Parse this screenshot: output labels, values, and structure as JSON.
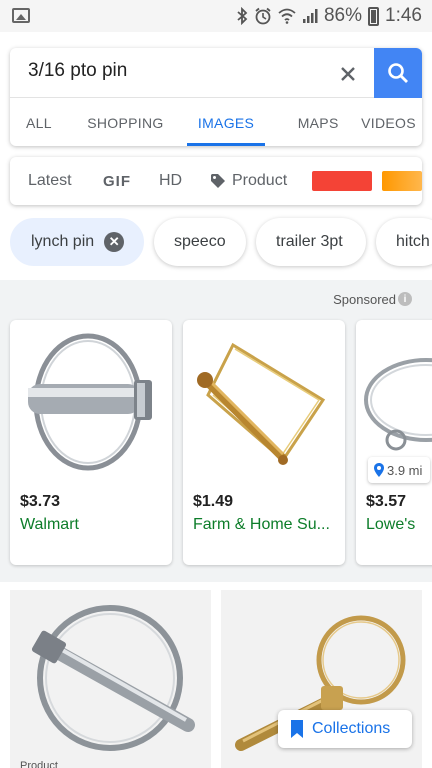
{
  "status_bar": {
    "battery": "86%",
    "time": "1:46",
    "icons": [
      "gallery-icon",
      "bluetooth-icon",
      "alarm-icon",
      "wifi-icon",
      "signal-icon",
      "battery-icon"
    ]
  },
  "search": {
    "query": "3/16 pto pin",
    "clear_icon": "close-icon",
    "search_icon": "search-icon",
    "accent": "#4285f4"
  },
  "tabs": [
    {
      "label": "ALL",
      "active": false
    },
    {
      "label": "SHOPPING",
      "active": false
    },
    {
      "label": "IMAGES",
      "active": true
    },
    {
      "label": "MAPS",
      "active": false
    },
    {
      "label": "VIDEOS",
      "active": false
    }
  ],
  "filters": {
    "latest": "Latest",
    "gif": "GIF",
    "hd": "HD",
    "product": "Product",
    "colors": [
      "#f44336",
      "#ff9800"
    ]
  },
  "chips": [
    {
      "label": "lynch pin",
      "active": true
    },
    {
      "label": "speeco",
      "active": false
    },
    {
      "label": "trailer 3pt",
      "active": false
    },
    {
      "label": "hitch",
      "active": false
    }
  ],
  "sponsored": {
    "label": "Sponsored",
    "items": [
      {
        "price": "$3.73",
        "store": "Walmart"
      },
      {
        "price": "$1.49",
        "store": "Farm & Home Su..."
      },
      {
        "price": "$3.57",
        "store": "Lowe's",
        "distance": "3.9 mi"
      }
    ]
  },
  "results": {
    "product_tag": "Product",
    "collections_label": "Collections"
  }
}
